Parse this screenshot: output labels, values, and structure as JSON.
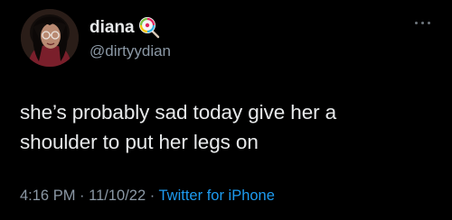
{
  "tweet": {
    "author": {
      "display_name": "diana",
      "name_emoji": "lollipop-emoji",
      "handle": "@dirtyydian",
      "avatar": "avatar-photo"
    },
    "menu_icon": "more-dots-icon",
    "text_lines": [
      "she’s probably sad today give her a",
      "shoulder to put her legs on"
    ],
    "timestamp": {
      "time": "4:16 PM",
      "separator": " · ",
      "date": "11/10/22",
      "source": "Twitter for iPhone"
    }
  },
  "colors": {
    "background": "#000000",
    "text_primary": "#e7e9ea",
    "text_secondary": "#8b98a5",
    "accent": "#1d9bf0"
  }
}
